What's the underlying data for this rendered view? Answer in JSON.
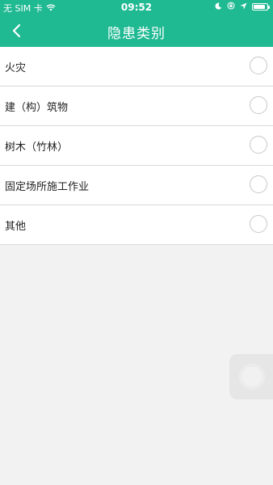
{
  "status": {
    "carrier": "无 SIM 卡",
    "time": "09:52"
  },
  "header": {
    "title": "隐患类别",
    "back_icon": "chevron-left-icon"
  },
  "options": [
    {
      "label": "火灾"
    },
    {
      "label": "建（构）筑物"
    },
    {
      "label": "树木（竹林）"
    },
    {
      "label": "固定场所施工作业"
    },
    {
      "label": "其他"
    }
  ],
  "colors": {
    "accent": "#1fb992",
    "background": "#f2f2f2"
  }
}
